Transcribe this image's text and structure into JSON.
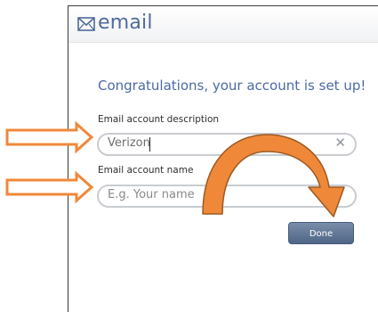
{
  "app": {
    "title": "email",
    "icon": "envelope-icon",
    "accent": "#4e6a9c"
  },
  "setup": {
    "heading": "Congratulations, your account is set up!",
    "description_label": "Email account description",
    "description_value": "Verizon",
    "clear_icon": "clear-icon",
    "clear_glyph": "✕",
    "name_label": "Email account name",
    "name_placeholder": "E.g. Your name",
    "done_label": "Done"
  },
  "annotations": {
    "arrow_color": "#f0883a",
    "items": [
      "arrow-to-description",
      "arrow-to-name",
      "curved-arrow-to-done"
    ]
  }
}
